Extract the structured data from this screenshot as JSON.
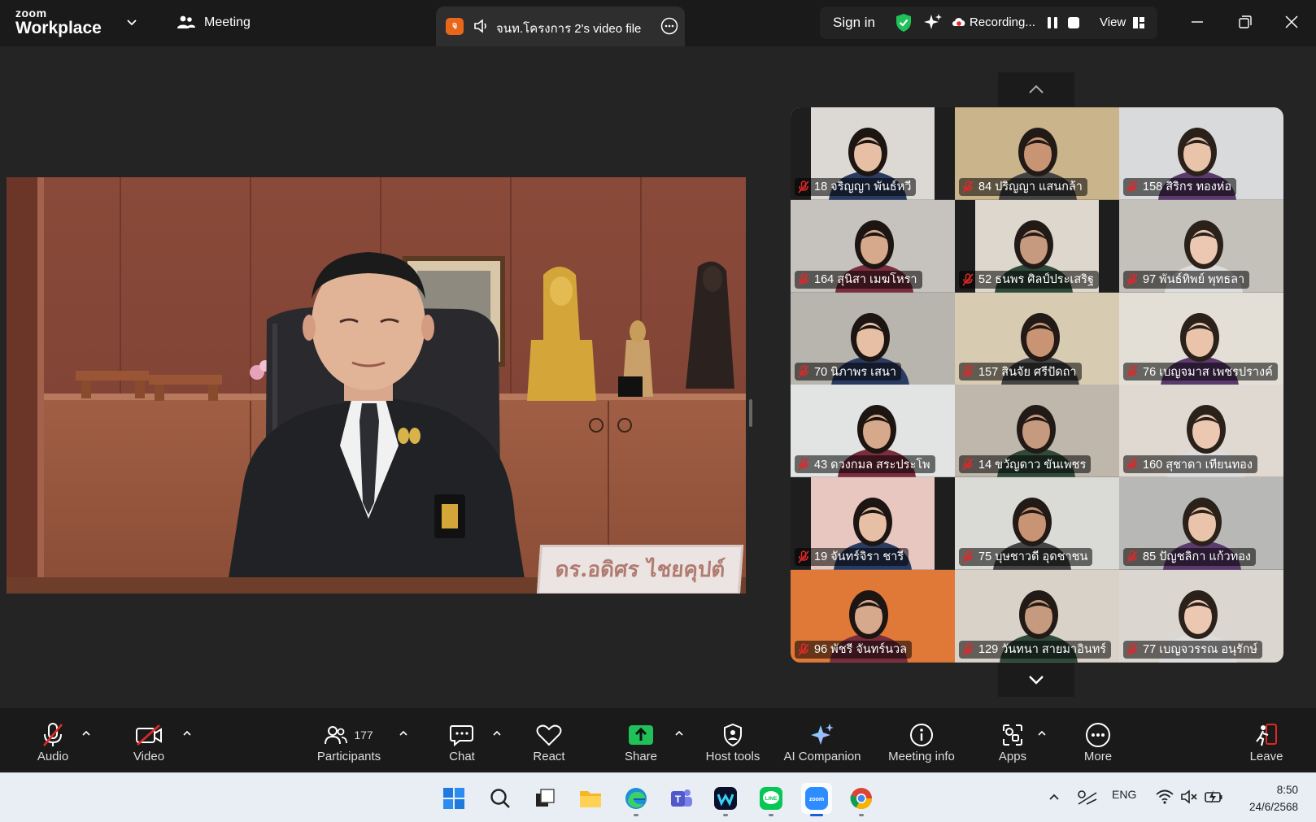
{
  "topbar": {
    "brand_small": "zoom",
    "brand_name": "Workplace",
    "meeting_label": "Meeting",
    "file_tab": {
      "badge": "จ",
      "title": "จนท.โครงการ 2's video file"
    },
    "sign_in": "Sign in",
    "recording": "Recording...",
    "view": "View"
  },
  "speaker": {
    "nameplate": "ดร.อดิศร ไชยคุปต์"
  },
  "gallery": {
    "tiles": [
      {
        "label": "18 จริญญา พันธ์หวี",
        "bg": "#dcd8d3"
      },
      {
        "label": "84 ปริญญา แสนกล้า",
        "bg": "#c9b48c"
      },
      {
        "label": "158 สิริกร ทองห่อ",
        "bg": "#d8dadb"
      },
      {
        "label": "164 สุนิสา เมฆโหรา",
        "bg": "#c6c2bd"
      },
      {
        "label": "52 ธนพร ศิลป์ประเสริฐ",
        "bg": "#ded7cd"
      },
      {
        "label": "97 พันธ์ทิพย์ พุทธลา",
        "bg": "#c4c1ba"
      },
      {
        "label": "70 นิภาพร เสนา",
        "bg": "#b8b4ae"
      },
      {
        "label": "157 สินจัย ศรีปัดถา",
        "bg": "#d7cbb1"
      },
      {
        "label": "76 เบญจมาส เพชรปรางค์",
        "bg": "#e3dfd7"
      },
      {
        "label": "43 ดวงกมล สระประโพ",
        "bg": "#e2e4e4"
      },
      {
        "label": "14 ขวัญดาว ขันเพชร",
        "bg": "#bfb7ab"
      },
      {
        "label": "160 สุชาดา เทียนทอง",
        "bg": "#dfd9d1"
      },
      {
        "label": "19 จันทร์จิรา ชารี",
        "bg": "#e7c7c0"
      },
      {
        "label": "75 บุษชาวดี อุดชาชน",
        "bg": "#dadad6"
      },
      {
        "label": "85 ปัญชลิกา แก้วทอง",
        "bg": "#b8b9b7"
      },
      {
        "label": "96 พัชรี จันทร์นวล",
        "bg": "#e07838"
      },
      {
        "label": "129 วันทนา สายมาอินทร์",
        "bg": "#d9d2c9"
      },
      {
        "label": "77 เบญจวรรณ อนุรักษ์",
        "bg": "#dbd6d0"
      }
    ]
  },
  "toolbar": {
    "audio": "Audio",
    "video": "Video",
    "participants": "Participants",
    "participants_count": "177",
    "chat": "Chat",
    "react": "React",
    "share": "Share",
    "host_tools": "Host tools",
    "ai_companion": "AI Companion",
    "meeting_info": "Meeting info",
    "apps": "Apps",
    "more": "More",
    "leave": "Leave"
  },
  "taskbar": {
    "lang": "ENG",
    "time": "8:50",
    "date": "24/6/2568"
  },
  "colors": {
    "accent_green": "#1fc158",
    "mute_red": "#e02828",
    "leave_red": "#e02828"
  }
}
